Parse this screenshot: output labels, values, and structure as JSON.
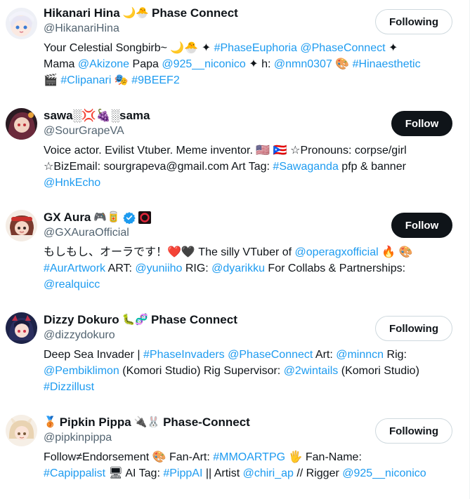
{
  "users": [
    {
      "name": "Hikanari Hina",
      "name_emoji": "🌙🐣",
      "name_suffix": "Phase Connect",
      "handle": "@HikanariHina",
      "button": "Following",
      "bio": {
        "l1": "Your Celestial Songbirb~ 🌙🐣 ✦ ",
        "l1_link1": "#PhaseEuphoria",
        "l1_link2": "@PhaseConnect",
        "l1_end": " ✦",
        "l2_a": "Mama ",
        "l2_link1": "@Akizone",
        "l2_b": " Papa ",
        "l2_link2": "@925__niconico",
        "l2_c": " ✦ h: ",
        "l2_link3": "@nmn0307",
        "l2_d": " 🎨 ",
        "l2_link4": "#Hinaesthetic",
        "l3_a": "🎬 ",
        "l3_link1": "#Clipanari",
        "l3_b": " 🎭 ",
        "l3_link2": "#9BEEF2"
      }
    },
    {
      "name": "sawa░💢🍇░sama",
      "handle": "@SourGrapeVA",
      "button": "Follow",
      "bio": {
        "l1": "Voice actor. Evilist Vtuber. Meme inventor. 🇺🇸 🇵🇷 ☆Pronouns: corpse/girl",
        "l2_a": "☆BizEmail: sourgrapeva@gmail.com Art Tag: ",
        "l2_link1": "#Sawaganda",
        "l2_b": " pfp & banner",
        "l3_link1": "@HnkEcho"
      }
    },
    {
      "name": "GX Aura",
      "name_emoji": "🎮🥫",
      "handle": "@GXAuraOfficial",
      "button": "Follow",
      "bio": {
        "l1_a": "もしもし、オーラです！❤️🖤 The silly VTuber of ",
        "l1_link1": "@operagxofficial",
        "l1_b": " 🔥 🎨",
        "l2_link1": "#AurArtwork",
        "l2_a": " ART: ",
        "l2_link2": "@yuniiho",
        "l2_b": " RIG: ",
        "l2_link3": "@dyarikku",
        "l2_c": " For Collabs & Partnerships:",
        "l3_link1": "@realquicc"
      }
    },
    {
      "name": "Dizzy Dokuro",
      "name_emoji": "🐛🧬",
      "name_suffix": "Phase Connect",
      "handle": "@dizzydokuro",
      "button": "Following",
      "bio": {
        "l1_a": "Deep Sea Invader | ",
        "l1_link1": "#PhaseInvaders",
        "l1_b": " ",
        "l1_link2": "@PhaseConnect",
        "l1_c": " Art: ",
        "l1_link3": "@minncn",
        "l1_d": " Rig:",
        "l2_link1": "@Pembiklimon",
        "l2_a": " (Komori Studio) Rig Supervisor: ",
        "l2_link2": "@2wintails",
        "l2_b": " (Komori Studio)",
        "l3_link1": "#Dizzillust"
      }
    },
    {
      "name": "Pipkin Pippa",
      "name_prefix_emoji": "🥉",
      "name_emoji": "🔌🐰",
      "name_suffix": "Phase-Connect",
      "handle": "@pipkinpippa",
      "button": "Following",
      "bio": {
        "l1_a": "Follow≠Endorsement 🎨 Fan-Art: ",
        "l1_link1": "#MMOARTPG",
        "l1_b": " 🖐 Fan-Name:",
        "l2_link1": "#Capippalist",
        "l2_a": " 🖥 AI Tag: ",
        "l2_link2": "#PippAI",
        "l2_b": " || Artist ",
        "l2_link3": "@chiri_ap",
        "l2_c": " // Rigger ",
        "l2_link4": "@925__niconico"
      }
    }
  ],
  "colors": {
    "text": "#0f1419",
    "secondary": "#536471",
    "link": "#1d9bf0",
    "follow_bg": "#0f1419",
    "following_border": "#cfd9de"
  }
}
